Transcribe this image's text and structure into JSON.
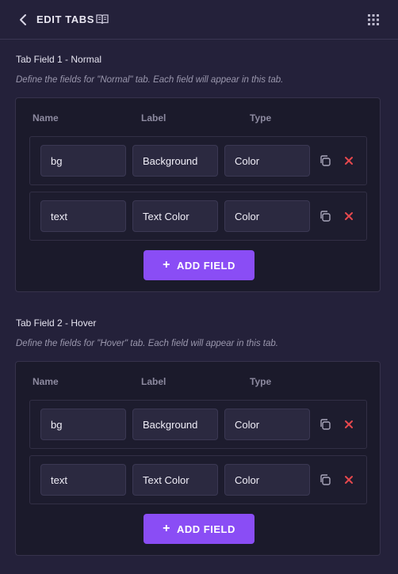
{
  "header": {
    "title": "EDIT TABS",
    "back_icon": "chevron-left-icon",
    "docs_icon": "book-open-icon",
    "menu_icon": "grid-dots-icon"
  },
  "colors": {
    "background": "#24213a",
    "panel": "#1b1a2b",
    "field": "#2b2940",
    "accent": "#8a4df5",
    "delete": "#e5484d"
  },
  "sections": [
    {
      "title": "Tab Field 1 - Normal",
      "description": "Define the fields for \"Normal\" tab. Each field will appear in this tab.",
      "columns": [
        "Name",
        "Label",
        "Type"
      ],
      "rows": [
        {
          "name": "bg",
          "label": "Background",
          "type": "Color"
        },
        {
          "name": "text",
          "label": "Text Color",
          "type": "Color"
        }
      ],
      "add_label": "ADD FIELD"
    },
    {
      "title": "Tab Field 2 - Hover",
      "description": "Define the fields for \"Hover\" tab. Each field will appear in this tab.",
      "columns": [
        "Name",
        "Label",
        "Type"
      ],
      "rows": [
        {
          "name": "bg",
          "label": "Background",
          "type": "Color"
        },
        {
          "name": "text",
          "label": "Text Color",
          "type": "Color"
        }
      ],
      "add_label": "ADD FIELD"
    }
  ]
}
